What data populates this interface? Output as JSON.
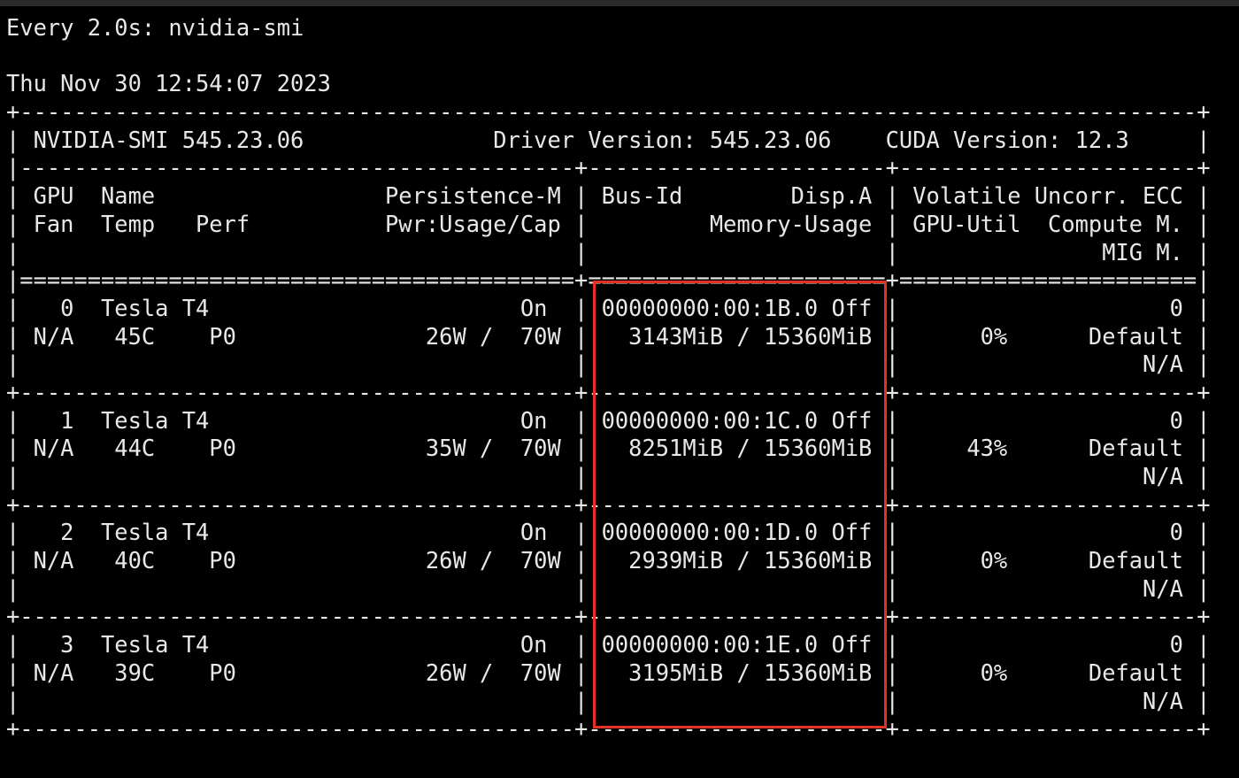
{
  "watch": {
    "header": "Every 2.0s: nvidia-smi",
    "timestamp": "Thu Nov 30 12:54:07 2023"
  },
  "smi_lines": [
    "+---------------------------------------------------------------------------------------+",
    "| NVIDIA-SMI 545.23.06              Driver Version: 545.23.06    CUDA Version: 12.3     |",
    "|-----------------------------------------+----------------------+----------------------+",
    "| GPU  Name                 Persistence-M | Bus-Id        Disp.A | Volatile Uncorr. ECC |",
    "| Fan  Temp   Perf          Pwr:Usage/Cap |         Memory-Usage | GPU-Util  Compute M. |",
    "|                                         |                      |               MIG M. |",
    "|=========================================+======================+======================|",
    "|   0  Tesla T4                       On  | 00000000:00:1B.0 Off |                    0 |",
    "| N/A   45C    P0              26W /  70W |   3143MiB / 15360MiB |      0%      Default |",
    "|                                         |                      |                  N/A |",
    "+-----------------------------------------+----------------------+----------------------+",
    "|   1  Tesla T4                       On  | 00000000:00:1C.0 Off |                    0 |",
    "| N/A   44C    P0              35W /  70W |   8251MiB / 15360MiB |     43%      Default |",
    "|                                         |                      |                  N/A |",
    "+-----------------------------------------+----------------------+----------------------+",
    "|   2  Tesla T4                       On  | 00000000:00:1D.0 Off |                    0 |",
    "| N/A   40C    P0              26W /  70W |   2939MiB / 15360MiB |      0%      Default |",
    "|                                         |                      |                  N/A |",
    "+-----------------------------------------+----------------------+----------------------+",
    "|   3  Tesla T4                       On  | 00000000:00:1E.0 Off |                    0 |",
    "| N/A   39C    P0              26W /  70W |   3195MiB / 15360MiB |      0%      Default |",
    "|                                         |                      |                  N/A |",
    "+-----------------------------------------+----------------------+----------------------+"
  ],
  "colors": {
    "background": "#000000",
    "text": "#e8e8e8",
    "highlight": "#e4321f"
  }
}
